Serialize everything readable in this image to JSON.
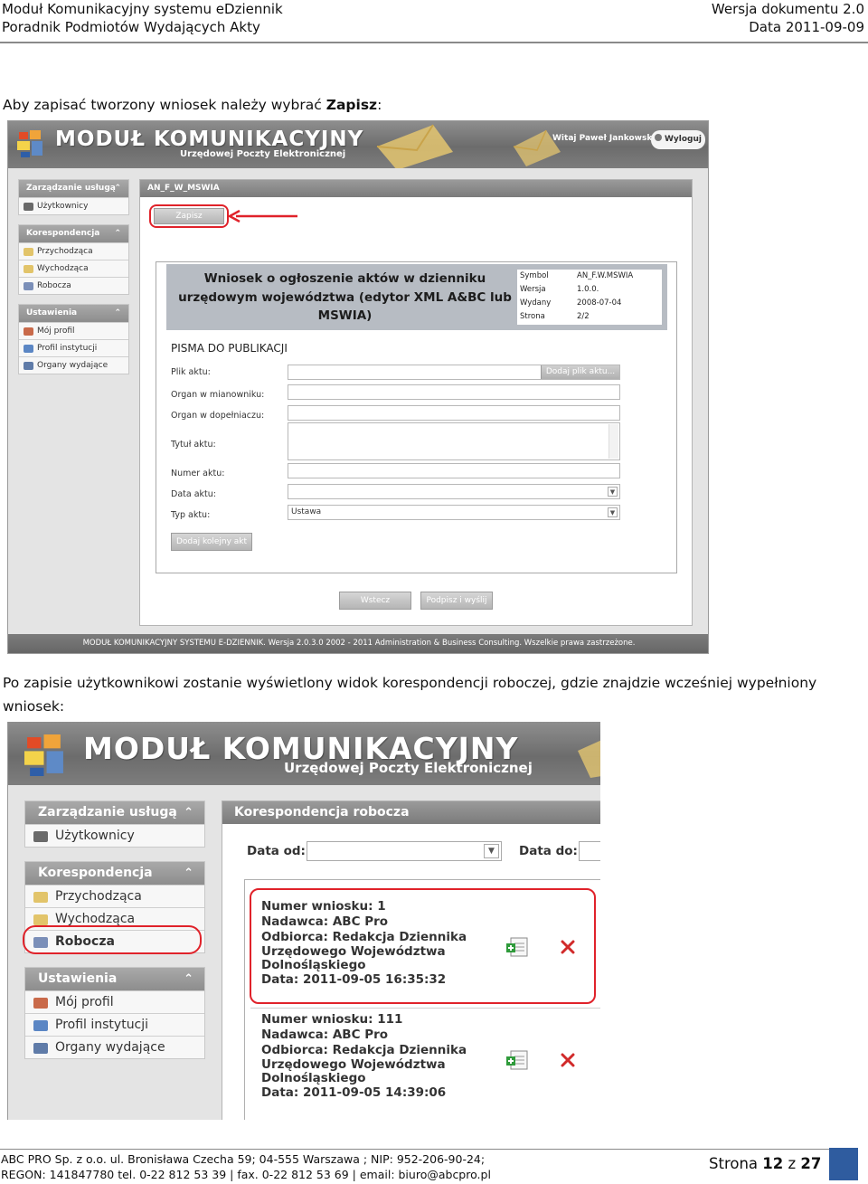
{
  "header": {
    "left_line1": "Moduł Komunikacyjny systemu eDziennik",
    "left_line2": "Poradnik Podmiotów Wydających Akty",
    "right_line1": "Wersja dokumentu 2.0",
    "right_line2": "Data 2011-09-09"
  },
  "para1": {
    "text": "Aby zapisać tworzony wniosek należy wybrać ",
    "bold": "Zapisz",
    "suffix": ":"
  },
  "screenshot1": {
    "banner_title": "MODUŁ KOMUNIKACYJNY",
    "banner_subtitle": "Urzędowej Poczty Elektronicznej",
    "welcome": "Witaj Paweł Jankowski",
    "logout": "Wyloguj",
    "sidebar": [
      {
        "head": "Zarządzanie usługą",
        "items": [
          "Użytkownicy"
        ]
      },
      {
        "head": "Korespondencja",
        "items": [
          "Przychodząca",
          "Wychodząca",
          "Robocza"
        ]
      },
      {
        "head": "Ustawienia",
        "items": [
          "Mój profil",
          "Profil instytucji",
          "Organy wydające"
        ]
      }
    ],
    "panel_title": "AN_F_W_MSWIA",
    "save_button": "Zapisz",
    "doc_title": "Wniosek o ogłoszenie aktów w dzienniku urzędowym województwa (edytor XML A&BC lub MSWIA)",
    "meta": [
      {
        "k": "Symbol",
        "v": "AN_F.W.MSWIA"
      },
      {
        "k": "Wersja",
        "v": "1.0.0."
      },
      {
        "k": "Wydany",
        "v": "2008-07-04"
      },
      {
        "k": "Strona",
        "v": "2/2"
      }
    ],
    "section": "PISMA DO PUBLIKACJI",
    "fields": {
      "plik_aktu": "Plik aktu:",
      "add_file": "Dodaj plik aktu...",
      "organ_mianownik": "Organ w mianowniku:",
      "organ_dopelniacz": "Organ w dopełniaczu:",
      "tytul_aktu": "Tytuł aktu:",
      "numer_aktu": "Numer aktu:",
      "data_aktu": "Data aktu:",
      "typ_aktu": "Typ aktu:",
      "typ_aktu_value": "Ustawa"
    },
    "add_next": "Dodaj kolejny akt",
    "back": "Wstecz",
    "sign_send": "Podpisz i wyślij",
    "footer": "MODUŁ KOMUNIKACYJNY SYSTEMU E-DZIENNIK. Wersja 2.0.3.0 2002 - 2011 Administration & Business Consulting. Wszelkie prawa zastrzeżone."
  },
  "para2": {
    "line1": "Po zapisie użytkownikowi zostanie wyświetlony widok korespondencji roboczej, gdzie znajdzie wcześniej wypełniony",
    "line2": "wniosek:"
  },
  "screenshot2": {
    "banner_title": "MODUŁ KOMUNIKACYJNY",
    "banner_subtitle": "Urzędowej Poczty Elektronicznej",
    "sidebar": [
      {
        "head": "Zarządzanie usługą",
        "items": [
          "Użytkownicy"
        ]
      },
      {
        "head": "Korespondencja",
        "items": [
          "Przychodząca",
          "Wychodząca",
          "Robocza"
        ]
      },
      {
        "head": "Ustawienia",
        "items": [
          "Mój profil",
          "Profil instytucji",
          "Organy wydające"
        ]
      }
    ],
    "panel_title": "Korespondencja robocza",
    "date_from": "Data od:",
    "date_to": "Data do:",
    "entries": [
      {
        "lines": [
          "Numer wniosku: 1",
          "Nadawca: ABC Pro",
          "Odbiorca: Redakcja Dziennika",
          "Urzędowego Województwa",
          "Dolnośląskiego",
          "Data: 2011-09-05 16:35:32"
        ]
      },
      {
        "lines": [
          "Numer wniosku: 111",
          "Nadawca: ABC Pro",
          "Odbiorca: Redakcja Dziennika",
          "Urzędowego Województwa",
          "Dolnośląskiego",
          "Data: 2011-09-05 14:39:06"
        ]
      }
    ]
  },
  "footer": {
    "line1": "ABC PRO Sp. z o.o. ul. Bronisława Czecha 59;  04-555 Warszawa ; NIP: 952-206-90-24;",
    "line2": "REGON: 141847780 tel. 0-22 812 53 39 | fax. 0-22 812 53 69 | email: biuro@abcpro.pl",
    "page_prefix": "Strona ",
    "page": "12",
    "page_mid": " z ",
    "total": "27"
  },
  "colors": {
    "highlight_red": "#e0222a",
    "footer_blue": "#2f5c9f"
  }
}
